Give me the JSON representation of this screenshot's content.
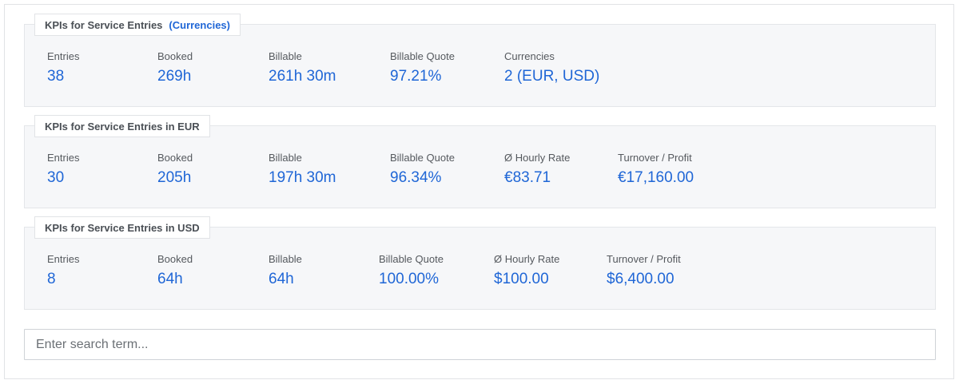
{
  "panels": [
    {
      "title": "KPIs for Service Entries",
      "link": "(Currencies)",
      "kpis": [
        {
          "label": "Entries",
          "value": "38"
        },
        {
          "label": "Booked",
          "value": "269h"
        },
        {
          "label": "Billable",
          "value": "261h 30m"
        },
        {
          "label": "Billable Quote",
          "value": "97.21%"
        },
        {
          "label": "Currencies",
          "value": "2 (EUR, USD)"
        }
      ]
    },
    {
      "title": "KPIs for Service Entries in EUR",
      "kpis": [
        {
          "label": "Entries",
          "value": "30"
        },
        {
          "label": "Booked",
          "value": "205h"
        },
        {
          "label": "Billable",
          "value": "197h 30m"
        },
        {
          "label": "Billable Quote",
          "value": "96.34%"
        },
        {
          "label": "Ø Hourly Rate",
          "value": "€83.71"
        },
        {
          "label": "Turnover / Profit",
          "value": "€17,160.00"
        }
      ]
    },
    {
      "title": "KPIs for Service Entries in USD",
      "kpis": [
        {
          "label": "Entries",
          "value": "8"
        },
        {
          "label": "Booked",
          "value": "64h"
        },
        {
          "label": "Billable",
          "value": "64h"
        },
        {
          "label": "Billable Quote",
          "value": "100.00%"
        },
        {
          "label": "Ø Hourly Rate",
          "value": "$100.00"
        },
        {
          "label": "Turnover / Profit",
          "value": "$6,400.00"
        }
      ]
    }
  ],
  "search": {
    "placeholder": "Enter search term..."
  },
  "colors": {
    "accent": "#1f66d6",
    "panel_bg": "#f6f7f9"
  }
}
